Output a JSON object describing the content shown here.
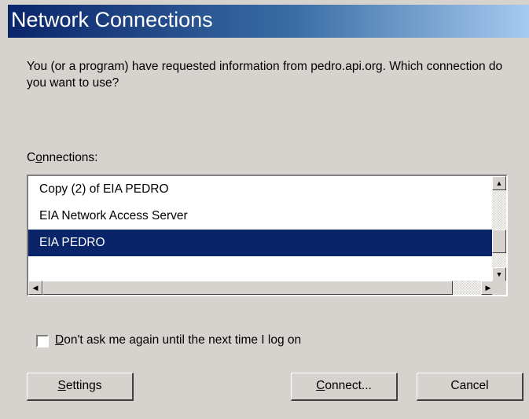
{
  "window": {
    "title": "Network Connections"
  },
  "prompt": {
    "text": "You (or a program) have requested information from pedro.api.org. Which connection do you want to use?"
  },
  "connections": {
    "label_pre": "C",
    "label_accel": "o",
    "label_post": "nnections:",
    "items": [
      {
        "label": "Copy (2) of EIA PEDRO",
        "selected": false
      },
      {
        "label": "EIA Network Access Server",
        "selected": false
      },
      {
        "label": "EIA PEDRO",
        "selected": true
      }
    ]
  },
  "checkbox": {
    "label_accel": "D",
    "label_rest": "on't ask me again until the next time I log on",
    "checked": false
  },
  "buttons": {
    "settings_accel": "S",
    "settings_rest": "ettings",
    "connect_accel": "C",
    "connect_rest": "onnect...",
    "cancel": "Cancel"
  },
  "colors": {
    "selection": "#0a246a",
    "title_start": "#0a246a",
    "title_end": "#a6caf0",
    "face": "#d6d3ce"
  },
  "icons": {
    "up": "scroll-up-arrow",
    "down": "scroll-down-arrow",
    "left": "scroll-left-arrow",
    "right": "scroll-right-arrow"
  }
}
